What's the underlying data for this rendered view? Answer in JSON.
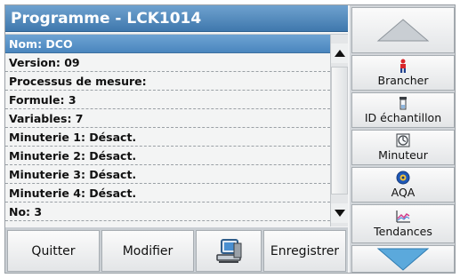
{
  "title": "Programme - LCK1014",
  "list": {
    "rows": [
      "Nom: DCO",
      "Version: 09",
      "Processus de mesure:",
      "Formule: 3",
      "Variables: 7",
      "Minuterie 1: Désact.",
      "Minuterie 2: Désact.",
      "Minuterie 3: Désact.",
      "Minuterie 4: Désact.",
      "No: 3"
    ],
    "selected_index": 0
  },
  "bottom": {
    "quitter": "Quitter",
    "modifier": "Modifier",
    "enregistrer": "Enregistrer"
  },
  "side": {
    "brancher": "Brancher",
    "id_echantillon": "ID échantillon",
    "minuteur": "Minuteur",
    "aqa": "AQA",
    "tendances": "Tendances"
  },
  "icons": {
    "up": "triangle-up-icon",
    "down": "triangle-down-icon",
    "computer": "computer-icon",
    "brancher": "person-icon",
    "id": "sample-vial-icon",
    "timer": "timer-icon",
    "aqa": "aqa-icon",
    "trend": "trend-chart-icon"
  },
  "colors": {
    "accent": "#4a86be",
    "title_bar": "#3f78ad"
  }
}
